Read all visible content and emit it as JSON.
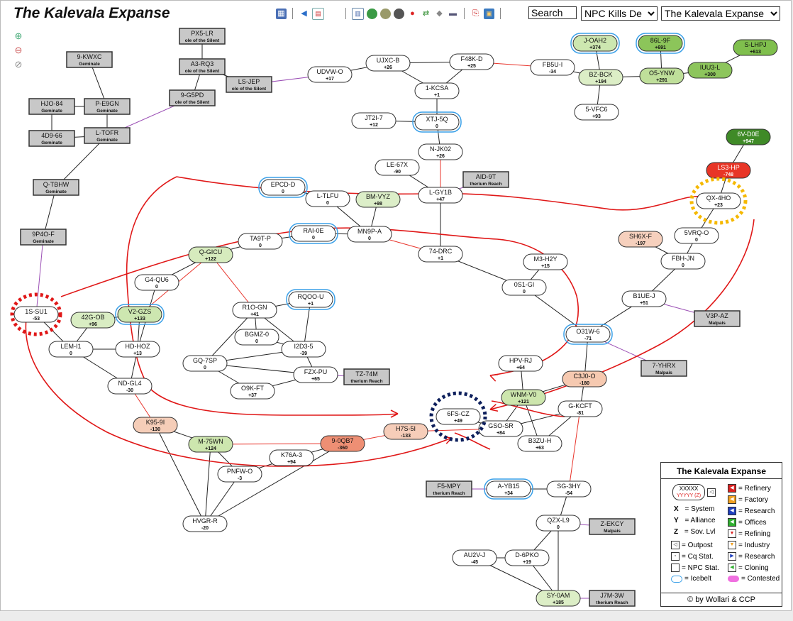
{
  "header": {
    "title": "The Kalevala Expanse",
    "search_value": "Search",
    "mode_select": "NPC Kills De",
    "region_select": "The Kalevala Expanse"
  },
  "toolbar": {
    "icons": [
      "map-icon",
      "back-icon",
      "calendar-icon",
      "table-icon",
      "globe-icon",
      "planet-icon",
      "moon-icon",
      "pin-icon",
      "route-icon",
      "cube-icon",
      "truck-icon",
      "pdf-icon",
      "image-icon"
    ]
  },
  "colors": {
    "jump_normal": "#222222",
    "jump_region": "#9b4fb5",
    "jump_constellation": "#e8332a",
    "annotation_red": "#e01818",
    "marker_red": "#e01818",
    "marker_yellow": "#f5b800",
    "marker_navy": "#0d1f5c",
    "icebelt": "#3aa0e8"
  },
  "systems": [
    {
      "name": "PX5-LR",
      "sov": "ole of the Silent",
      "type": "ext"
    },
    {
      "name": "A3-RQ3",
      "sov": "ole of the Silent",
      "type": "ext"
    },
    {
      "name": "LS-JEP",
      "sov": "ole of the Silent",
      "type": "ext"
    },
    {
      "name": "9-G5PD",
      "sov": "ole of the Silent",
      "type": "ext"
    },
    {
      "name": "9-KWXC",
      "sov": "Geminate",
      "type": "ext"
    },
    {
      "name": "HJO-84",
      "sov": "Geminate",
      "type": "ext"
    },
    {
      "name": "P-E9GN",
      "sov": "Geminate",
      "type": "ext"
    },
    {
      "name": "4D9-66",
      "sov": "Geminate",
      "type": "ext"
    },
    {
      "name": "L-TOFR",
      "sov": "Geminate",
      "type": "ext"
    },
    {
      "name": "Q-TBHW",
      "sov": "Geminate",
      "type": "ext"
    },
    {
      "name": "9P4O-F",
      "sov": "Geminate",
      "type": "ext"
    },
    {
      "name": "UDVW-O",
      "sov": "+17",
      "type": "sys"
    },
    {
      "name": "UJXC-B",
      "sov": "+26",
      "type": "sys"
    },
    {
      "name": "F48K-D",
      "sov": "+25",
      "type": "sys"
    },
    {
      "name": "1-KCSA",
      "sov": "+1",
      "type": "sys"
    },
    {
      "name": "FB5U-I",
      "sov": "-34",
      "type": "sys"
    },
    {
      "name": "J-OAH2",
      "sov": "+374",
      "type": "sys"
    },
    {
      "name": "86L-9F",
      "sov": "+691",
      "type": "sys"
    },
    {
      "name": "S-LHPJ",
      "sov": "+613",
      "type": "sys"
    },
    {
      "name": "BZ-BCK",
      "sov": "+194",
      "type": "sys"
    },
    {
      "name": "O5-YNW",
      "sov": "+291",
      "type": "sys"
    },
    {
      "name": "IUU3-L",
      "sov": "+300",
      "type": "sys"
    },
    {
      "name": "5-VFC6",
      "sov": "+93",
      "type": "sys"
    },
    {
      "name": "JT2I-7",
      "sov": "+12",
      "type": "sys"
    },
    {
      "name": "XTJ-5Q",
      "sov": "0",
      "type": "sys"
    },
    {
      "name": "N-JK02",
      "sov": "+26",
      "type": "sys"
    },
    {
      "name": "6V-D0E",
      "sov": "+947",
      "type": "sys"
    },
    {
      "name": "LE-67X",
      "sov": "-90",
      "type": "sys"
    },
    {
      "name": "AID-9T",
      "sov": "therium Reach",
      "type": "ext"
    },
    {
      "name": "EPCD-D",
      "sov": "0",
      "type": "sys"
    },
    {
      "name": "L-TLFU",
      "sov": "0",
      "type": "sys"
    },
    {
      "name": "BM-VYZ",
      "sov": "+98",
      "type": "sys"
    },
    {
      "name": "L-GY1B",
      "sov": "+47",
      "type": "sys"
    },
    {
      "name": "LS3-HP",
      "sov": "-748",
      "type": "sys"
    },
    {
      "name": "QX-4HO",
      "sov": "+23",
      "type": "sys"
    },
    {
      "name": "TA9T-P",
      "sov": "0",
      "type": "sys"
    },
    {
      "name": "RAI-0E",
      "sov": "0",
      "type": "sys"
    },
    {
      "name": "MN9P-A",
      "sov": "0",
      "type": "sys"
    },
    {
      "name": "SH6X-F",
      "sov": "-197",
      "type": "sys"
    },
    {
      "name": "5VRQ-O",
      "sov": "0",
      "type": "sys"
    },
    {
      "name": "Q-GICU",
      "sov": "+122",
      "type": "sys"
    },
    {
      "name": "74-DRC",
      "sov": "+1",
      "type": "sys"
    },
    {
      "name": "M3-H2Y",
      "sov": "+15",
      "type": "sys"
    },
    {
      "name": "FBH-JN",
      "sov": "0",
      "type": "sys"
    },
    {
      "name": "G4-QU6",
      "sov": "0",
      "type": "sys"
    },
    {
      "name": "0S1-GI",
      "sov": "0",
      "type": "sys"
    },
    {
      "name": "RQOO-U",
      "sov": "+1",
      "type": "sys"
    },
    {
      "name": "B1UE-J",
      "sov": "+51",
      "type": "sys"
    },
    {
      "name": "1S-SU1",
      "sov": "-53",
      "type": "sys"
    },
    {
      "name": "42G-OB",
      "sov": "+96",
      "type": "sys"
    },
    {
      "name": "V2-GZS",
      "sov": "+133",
      "type": "sys"
    },
    {
      "name": "R1O-GN",
      "sov": "+41",
      "type": "sys"
    },
    {
      "name": "V3P-AZ",
      "sov": "Malpais",
      "type": "ext"
    },
    {
      "name": "BGMZ-0",
      "sov": "0",
      "type": "sys"
    },
    {
      "name": "O31W-6",
      "sov": "-71",
      "type": "sys"
    },
    {
      "name": "LEM-I1",
      "sov": "0",
      "type": "sys"
    },
    {
      "name": "HD-HOZ",
      "sov": "+13",
      "type": "sys"
    },
    {
      "name": "I2D3-5",
      "sov": "-39",
      "type": "sys"
    },
    {
      "name": "GQ-7SP",
      "sov": "0",
      "type": "sys"
    },
    {
      "name": "HPV-RJ",
      "sov": "+64",
      "type": "sys"
    },
    {
      "name": "7-YHRX",
      "sov": "Malpais",
      "type": "ext"
    },
    {
      "name": "FZX-PU",
      "sov": "+65",
      "type": "sys"
    },
    {
      "name": "TZ-74M",
      "sov": "therium Reach",
      "type": "ext"
    },
    {
      "name": "C3J0-O",
      "sov": "-180",
      "type": "sys"
    },
    {
      "name": "ND-GL4",
      "sov": "-30",
      "type": "sys"
    },
    {
      "name": "O9K-FT",
      "sov": "+37",
      "type": "sys"
    },
    {
      "name": "WNM-V0",
      "sov": "+121",
      "type": "sys"
    },
    {
      "name": "G-KCFT",
      "sov": "-81",
      "type": "sys"
    },
    {
      "name": "6FS-CZ",
      "sov": "+49",
      "type": "sys"
    },
    {
      "name": "K95-9I",
      "sov": "-130",
      "type": "sys"
    },
    {
      "name": "H7S-5I",
      "sov": "-133",
      "type": "sys"
    },
    {
      "name": "GSO-SR",
      "sov": "+84",
      "type": "sys"
    },
    {
      "name": "M-75WN",
      "sov": "+124",
      "type": "sys"
    },
    {
      "name": "9-0QB7",
      "sov": "-360",
      "type": "sys"
    },
    {
      "name": "B3ZU-H",
      "sov": "+63",
      "type": "sys"
    },
    {
      "name": "K76A-3",
      "sov": "+94",
      "type": "sys"
    },
    {
      "name": "PNFW-O",
      "sov": "-3",
      "type": "sys"
    },
    {
      "name": "F5-MPY",
      "sov": "therium Reach",
      "type": "ext"
    },
    {
      "name": "A-YB15",
      "sov": "+34",
      "type": "sys"
    },
    {
      "name": "SG-3HY",
      "sov": "-54",
      "type": "sys"
    },
    {
      "name": "HVGR-R",
      "sov": "-20",
      "type": "sys"
    },
    {
      "name": "QZX-L9",
      "sov": "0",
      "type": "sys"
    },
    {
      "name": "Z-EKCY",
      "sov": "Malpais",
      "type": "ext"
    },
    {
      "name": "AU2V-J",
      "sov": "-45",
      "type": "sys"
    },
    {
      "name": "D-6PKO",
      "sov": "+19",
      "type": "sys"
    },
    {
      "name": "SY-0AM",
      "sov": "+185",
      "type": "sys"
    },
    {
      "name": "J7M-3W",
      "sov": "therium Reach",
      "type": "ext"
    }
  ],
  "legend": {
    "title": "The Kalevala Expanse",
    "sample_name": "XXXXX",
    "sample_sub": "YYYYY (Z)",
    "x_label": "= System",
    "y_label": "= Alliance",
    "z_label": "= Sov. Lvl",
    "outpost": "= Outpost",
    "cq": "= Cq Stat.",
    "npc": "= NPC Stat.",
    "icebelt": "= Icebelt",
    "refinery": "= Refinery",
    "factory": "= Factory",
    "research1": "= Research",
    "offices": "= Offices",
    "refining": "= Refining",
    "industry": "= Industry",
    "research2": "= Research",
    "cloning": "= Cloning",
    "contested": "= Contested",
    "credit": "© by Wollari & CCP"
  }
}
